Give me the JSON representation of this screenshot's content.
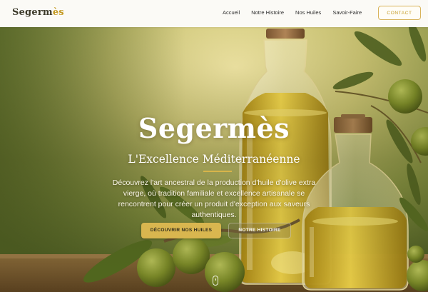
{
  "header": {
    "logo": {
      "text": "Segerm",
      "accent": "ès"
    },
    "nav": [
      "Accueil",
      "Notre Histoire",
      "Nos Huiles",
      "Savoir-Faire"
    ],
    "contact_label": "CONTACT"
  },
  "hero": {
    "title": "Segermès",
    "subtitle": "L'Excellence Méditerranéenne",
    "description": "Découvrez l'art ancestral de la production d'huile d'olive extra vierge, où tradition familiale et excellence artisanale se rencontrent pour créer un produit d'exception aux saveurs authentiques.",
    "primary_button": "DÉCOUVRIR NOS HUILES",
    "secondary_button": "NOTRE HISTOIRE"
  },
  "colors": {
    "accent": "#d9b64f",
    "header_bg": "#fbfaf6"
  },
  "icons": {
    "scroll": "mouse-scroll-icon"
  }
}
